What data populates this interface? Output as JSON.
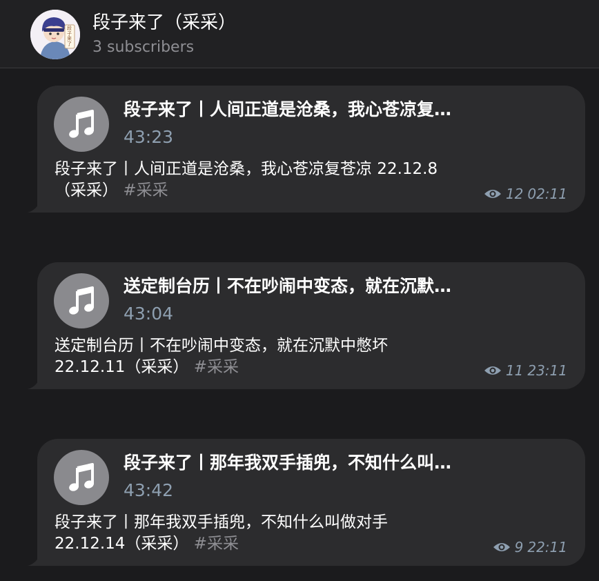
{
  "channel": {
    "title": "段子来了（采采）",
    "subscribers": "3 subscribers",
    "avatar_text": "段子来了"
  },
  "messages": [
    {
      "audio_title": "段子来了丨人间正道是沧桑，我心苍凉复…",
      "duration": "43:23",
      "caption_line1": "段子来了丨人间正道是沧桑，我心苍凉复苍凉 22.12.8",
      "caption_line2": "（采采）",
      "hashtag": "#采采",
      "views": "12",
      "time": "02:11",
      "icon": "music-note-icon"
    },
    {
      "audio_title": "送定制台历丨不在吵闹中变态，就在沉默…",
      "duration": "43:04",
      "caption_line1": "送定制台历丨不在吵闹中变态，就在沉默中憋坏",
      "caption_line2": "22.12.11（采采）",
      "hashtag": "#采采",
      "views": "11",
      "time": "23:11",
      "icon": "music-note-icon"
    },
    {
      "audio_title": "段子来了丨那年我双手插兜，不知什么叫…",
      "duration": "43:42",
      "caption_line1": "段子来了丨那年我双手插兜，不知什么叫做对手",
      "caption_line2": "22.12.14（采采）",
      "hashtag": "#采采",
      "views": "9",
      "time": "22:11",
      "icon": "music-note-icon"
    }
  ],
  "colors": {
    "background": "#1b1b1d",
    "header": "#212123",
    "bubble": "#2c2c2e",
    "play_button": "#8a8a8e",
    "secondary_text": "#8e9fb0",
    "hashtag": "#8e8e93"
  }
}
